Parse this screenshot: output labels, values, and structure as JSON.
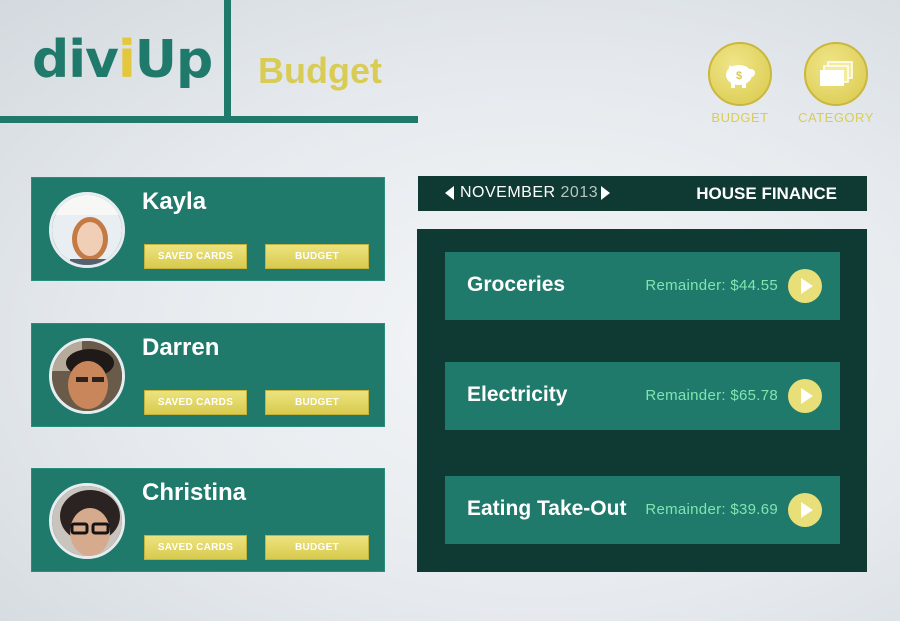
{
  "header": {
    "logo_prefix": "div",
    "logo_i": "i",
    "logo_suffix": "Up",
    "page_title": "Budget",
    "nav": [
      {
        "label": "BUDGET",
        "icon": "piggy-bank-icon"
      },
      {
        "label": "CATEGORY",
        "icon": "stacked-cards-icon"
      }
    ]
  },
  "members": [
    {
      "name": "Kayla",
      "saved_cards_label": "SAVED CARDS",
      "budget_label": "BUDGET"
    },
    {
      "name": "Darren",
      "saved_cards_label": "SAVED CARDS",
      "budget_label": "BUDGET"
    },
    {
      "name": "Christina",
      "saved_cards_label": "SAVED CARDS",
      "budget_label": "BUDGET"
    }
  ],
  "finance": {
    "month": "NOVEMBER",
    "year": "2013",
    "group_name": "HOUSE FINANCE",
    "categories": [
      {
        "name": "Groceries",
        "remainder": "Remainder: $44.55"
      },
      {
        "name": "Electricity",
        "remainder": "Remainder: $65.78"
      },
      {
        "name": "Eating Take-Out",
        "remainder": "Remainder: $39.69"
      }
    ]
  },
  "colors": {
    "teal": "#1f7a6b",
    "dark_teal": "#0f3a33",
    "yellow": "#d9cc55",
    "remainder_green": "#7fe6b0"
  }
}
